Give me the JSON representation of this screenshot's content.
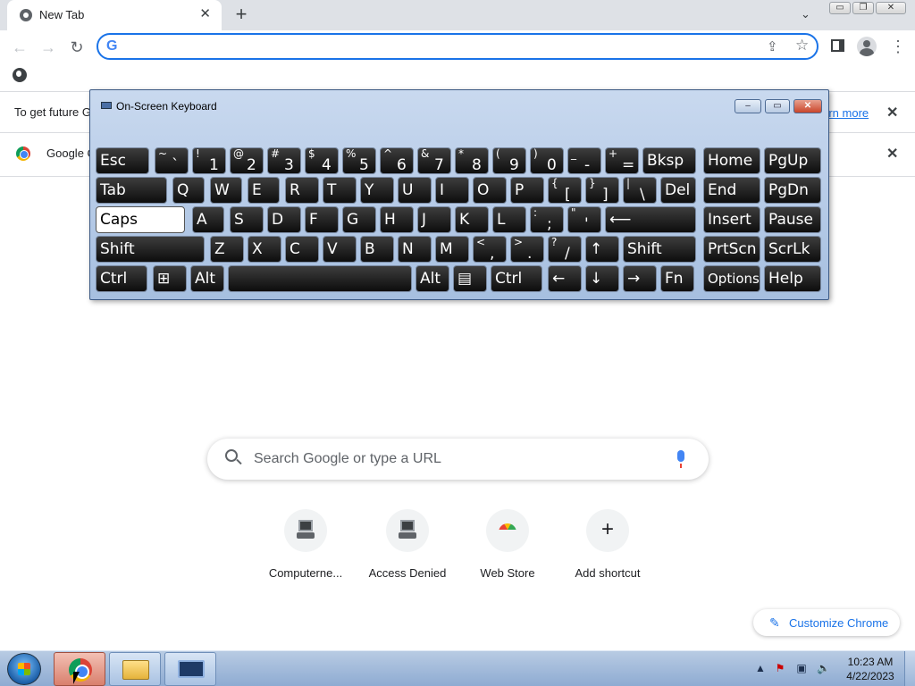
{
  "browser": {
    "tab_title": "New Tab",
    "tab_close": "✕",
    "new_tab": "+",
    "tab_search": "⌄",
    "window_minimize": "▭",
    "window_restore": "❐",
    "window_close": "✕",
    "omnibox_value": "",
    "omnibox_icon": "G",
    "infobar1_text": "To get future G",
    "infobar1_link": "learn more",
    "infobar2_text": "Google C",
    "infobar_close": "✕"
  },
  "osk": {
    "title": "On-Screen Keyboard",
    "rows": [
      [
        {
          "main": "Esc"
        },
        {
          "top": "~",
          "bot": "`"
        },
        {
          "top": "!",
          "bot": "1"
        },
        {
          "top": "@",
          "bot": "2"
        },
        {
          "top": "#",
          "bot": "3"
        },
        {
          "top": "$",
          "bot": "4"
        },
        {
          "top": "%",
          "bot": "5"
        },
        {
          "top": "^",
          "bot": "6"
        },
        {
          "top": "&",
          "bot": "7"
        },
        {
          "top": "*",
          "bot": "8"
        },
        {
          "top": "(",
          "bot": "9"
        },
        {
          "top": ")",
          "bot": "0"
        },
        {
          "top": "_",
          "bot": "-"
        },
        {
          "top": "+",
          "bot": "="
        },
        {
          "main": "Bksp"
        },
        {
          "main": "Home"
        },
        {
          "main": "PgUp"
        }
      ],
      [
        {
          "main": "Tab"
        },
        {
          "main": "Q"
        },
        {
          "main": "W"
        },
        {
          "main": "E"
        },
        {
          "main": "R"
        },
        {
          "main": "T"
        },
        {
          "main": "Y"
        },
        {
          "main": "U"
        },
        {
          "main": "I"
        },
        {
          "main": "O"
        },
        {
          "main": "P"
        },
        {
          "top": "{",
          "bot": "["
        },
        {
          "top": "}",
          "bot": "]"
        },
        {
          "top": "|",
          "bot": "\\"
        },
        {
          "main": "Del"
        },
        {
          "main": "End"
        },
        {
          "main": "PgDn"
        }
      ],
      [
        {
          "main": "Caps"
        },
        {
          "main": "A"
        },
        {
          "main": "S"
        },
        {
          "main": "D"
        },
        {
          "main": "F"
        },
        {
          "main": "G"
        },
        {
          "main": "H"
        },
        {
          "main": "J"
        },
        {
          "main": "K"
        },
        {
          "main": "L"
        },
        {
          "top": ":",
          "bot": ";"
        },
        {
          "top": "\"",
          "bot": "'"
        },
        {
          "main": "⟵"
        },
        {
          "main": "Insert"
        },
        {
          "main": "Pause"
        }
      ],
      [
        {
          "main": "Shift"
        },
        {
          "main": "Z"
        },
        {
          "main": "X"
        },
        {
          "main": "C"
        },
        {
          "main": "V"
        },
        {
          "main": "B"
        },
        {
          "main": "N"
        },
        {
          "main": "M"
        },
        {
          "top": "<",
          "bot": ","
        },
        {
          "top": ">",
          "bot": "."
        },
        {
          "top": "?",
          "bot": "/"
        },
        {
          "main": "↑"
        },
        {
          "main": "Shift"
        },
        {
          "main": "PrtScn"
        },
        {
          "main": "ScrLk"
        }
      ],
      [
        {
          "main": "Ctrl"
        },
        {
          "main": "⊞"
        },
        {
          "main": "Alt"
        },
        {
          "main": ""
        },
        {
          "main": "Alt"
        },
        {
          "main": "▤"
        },
        {
          "main": "Ctrl"
        },
        {
          "main": "←"
        },
        {
          "main": "↓"
        },
        {
          "main": "→"
        },
        {
          "main": "Fn"
        },
        {
          "main": "Options"
        },
        {
          "main": "Help"
        }
      ]
    ]
  },
  "newtab": {
    "search_placeholder": "Search Google or type a URL",
    "shortcuts": [
      {
        "label": "Computerne...",
        "icon": "computer-icon"
      },
      {
        "label": "Access Denied",
        "icon": "computer-icon"
      },
      {
        "label": "Web Store",
        "icon": "web-store-icon"
      },
      {
        "label": "Add shortcut",
        "icon": "plus-icon"
      }
    ],
    "customize_label": "Customize Chrome",
    "customize_icon": "✎",
    "add_symbol": "+"
  },
  "taskbar": {
    "time": "10:23 AM",
    "date": "4/22/2023",
    "tray_arrow": "▲"
  },
  "colors": {
    "accent": "#1a73e8",
    "tab_strip": "#dee1e6"
  }
}
